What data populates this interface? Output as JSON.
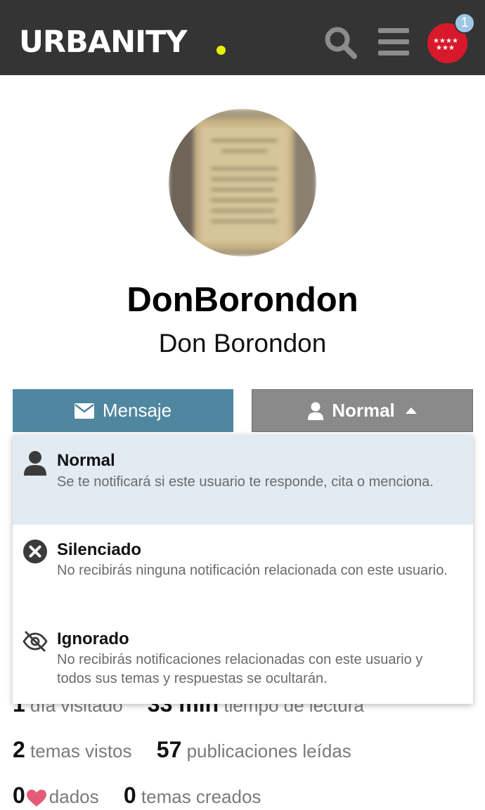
{
  "header": {
    "logo": "URBANITY",
    "notification_count": "1",
    "search_icon": "search-icon",
    "menu_icon": "hamburger-icon",
    "avatar_icon": "stars-flag-icon"
  },
  "profile": {
    "username": "DonBorondon",
    "full_name": "Don Borondon"
  },
  "actions": {
    "message_label": "Mensaje",
    "message_icon": "envelope-icon",
    "level_label": "Normal",
    "level_icon": "user-icon"
  },
  "notification_menu": {
    "options": [
      {
        "title": "Normal",
        "description": "Se te notificará si este usuario te responde, cita o menciona.",
        "icon": "user-icon",
        "selected": true
      },
      {
        "title": "Silenciado",
        "description": "No recibirás ninguna notificación relacionada con este usuario.",
        "icon": "times-circle-icon",
        "selected": false
      },
      {
        "title": "Ignorado",
        "description": "No recibirás notificaciones relacionadas con este usuario y todos sus temas y respuestas se ocultarán.",
        "icon": "eye-slash-icon",
        "selected": false
      }
    ]
  },
  "stats": {
    "days_visited_value": "1",
    "days_visited_label": "día visitado",
    "read_time_value": "33 min",
    "read_time_label": "tiempo de lectura",
    "topics_viewed_value": "2",
    "topics_viewed_label": "temas vistos",
    "posts_read_value": "57",
    "posts_read_label": "publicaciones leídas",
    "likes_given_value": "0",
    "likes_given_label": "dados",
    "topics_created_value": "0",
    "topics_created_label": "temas creados"
  },
  "colors": {
    "header_bg": "#343434",
    "logo_dot": "#e6f000",
    "message_button": "#4f87a0",
    "level_button": "#8a8a8a",
    "selected_option_bg": "#e2ebf2",
    "badge": "#9fc7e5",
    "heart": "#e45b7a"
  }
}
